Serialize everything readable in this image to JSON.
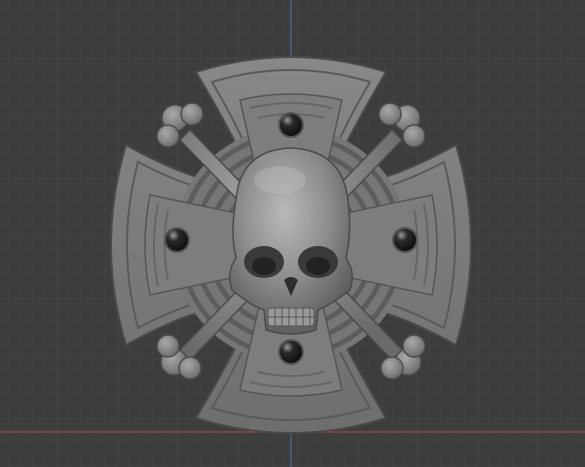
{
  "viewport": {
    "view": "front-orthographic",
    "background_color": "#3d3d3d",
    "grid": true,
    "grid_minor_color": "#444444",
    "grid_major_color": "#4f4f4f",
    "x_axis_color": "#b54a55",
    "z_axis_color": "#4a72b8"
  },
  "model": {
    "object": "skull-crossbones-cross-medallion",
    "material_color": "#7a7a7a",
    "parts": [
      "iron-cross",
      "concentric-ring-disc",
      "crossed-bones",
      "skull",
      "rivets"
    ],
    "rivet_count": 4
  }
}
